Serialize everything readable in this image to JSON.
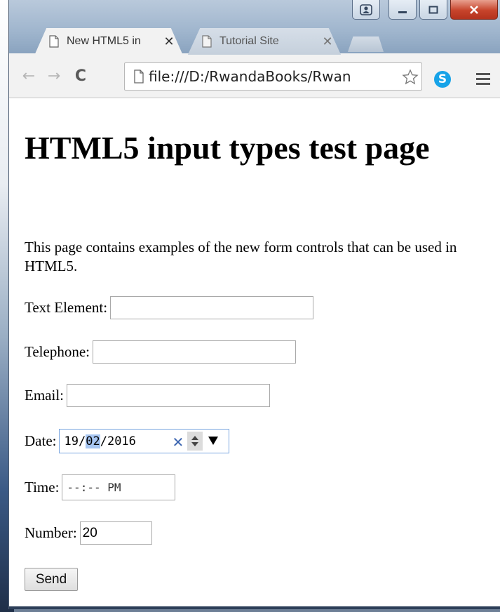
{
  "browser": {
    "tabs": [
      {
        "label": "New HTML5 in",
        "active": true
      },
      {
        "label": "Tutorial Site",
        "active": false
      }
    ],
    "address": "file:///D:/RwandaBooks/Rwan",
    "window_controls": [
      "user-icon",
      "minimize-icon",
      "maximize-icon",
      "close-icon"
    ],
    "accent_close": "#c7442b"
  },
  "page": {
    "title": "HTML5 input types test page",
    "intro": "This page contains examples of the new form controls that can be used in HTML5.",
    "fields": {
      "text": {
        "label": "Text Element:",
        "value": ""
      },
      "telephone": {
        "label": "Telephone:",
        "value": ""
      },
      "email": {
        "label": "Email:",
        "value": ""
      },
      "date": {
        "label": "Date:",
        "day": "19",
        "month": "02",
        "year": "2016",
        "sep": "/"
      },
      "time": {
        "label": "Time:",
        "value": "--:-- PM"
      },
      "number": {
        "label": "Number:",
        "value": "20"
      }
    },
    "send_label": "Send"
  }
}
